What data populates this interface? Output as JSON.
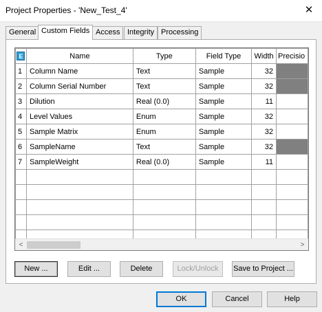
{
  "window": {
    "title": "Project Properties - 'New_Test_4'",
    "close_glyph": "✕"
  },
  "tabs": [
    {
      "label": "General"
    },
    {
      "label": "Custom Fields",
      "active": true
    },
    {
      "label": "Access"
    },
    {
      "label": "Integrity"
    },
    {
      "label": "Processing"
    }
  ],
  "grid": {
    "corner_icon": "E",
    "columns": [
      "Name",
      "Type",
      "Field Type",
      "Width",
      "Precisio"
    ],
    "rows": [
      {
        "num": "1",
        "name": "Column Name",
        "type": "Text",
        "field_type": "Sample",
        "width": "32",
        "precision": "",
        "precision_disabled": true
      },
      {
        "num": "2",
        "name": "Column Serial Number",
        "type": "Text",
        "field_type": "Sample",
        "width": "32",
        "precision": "",
        "precision_disabled": true
      },
      {
        "num": "3",
        "name": "Dilution",
        "type": "Real (0.0)",
        "field_type": "Sample",
        "width": "11",
        "precision": "",
        "precision_disabled": false
      },
      {
        "num": "4",
        "name": "Level Values",
        "type": "Enum",
        "field_type": "Sample",
        "width": "32",
        "precision": "",
        "precision_disabled": false
      },
      {
        "num": "5",
        "name": "Sample Matrix",
        "type": "Enum",
        "field_type": "Sample",
        "width": "32",
        "precision": "",
        "precision_disabled": false
      },
      {
        "num": "6",
        "name": "SampleName",
        "type": "Text",
        "field_type": "Sample",
        "width": "32",
        "precision": "",
        "precision_disabled": true
      },
      {
        "num": "7",
        "name": "SampleWeight",
        "type": "Real (0.0)",
        "field_type": "Sample",
        "width": "11",
        "precision": "",
        "precision_disabled": false
      }
    ],
    "empty_rows": 5,
    "scroll_left_glyph": "<",
    "scroll_right_glyph": ">"
  },
  "actions": {
    "new": "New ...",
    "edit": "Edit ...",
    "delete": "Delete",
    "lock_unlock": "Lock/Unlock",
    "save_to_project": "Save to Project ..."
  },
  "footer": {
    "ok": "OK",
    "cancel": "Cancel",
    "help": "Help"
  }
}
